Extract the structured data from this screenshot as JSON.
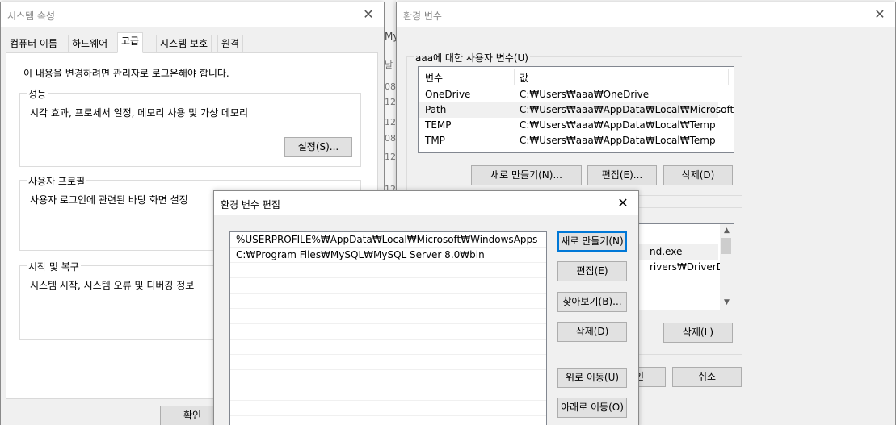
{
  "system_properties": {
    "title": "시스템 속성",
    "tabs": [
      {
        "label": "컴퓨터 이름"
      },
      {
        "label": "하드웨어"
      },
      {
        "label": "고급"
      },
      {
        "label": "시스템 보호"
      },
      {
        "label": "원격"
      }
    ],
    "admin_notice": "이 내용을 변경하려면 관리자로 로그온해야 합니다.",
    "performance": {
      "title": "성능",
      "description": "시각 효과, 프로세서 일정, 메모리 사용 및 가상 메모리",
      "settings_button": "설정(S)..."
    },
    "user_profile": {
      "title": "사용자 프로필",
      "description": "사용자 로그인에 관련된 바탕 화면 설정"
    },
    "startup_recovery": {
      "title": "시작 및 복구",
      "description": "시스템 시작, 시스템 오류 및 디버깅 정보"
    },
    "ok_button": "확인"
  },
  "background_fragments": [
    "My",
    "날",
    "08",
    "12",
    "12",
    "08",
    "12",
    "12"
  ],
  "environment_variables": {
    "title": "환경 변수",
    "user_group_title": "aaa에 대한 사용자 변수(U)",
    "columns": {
      "name": "변수",
      "value": "값"
    },
    "user_vars": [
      {
        "name": "OneDrive",
        "value": "C:₩Users₩aaa₩OneDrive"
      },
      {
        "name": "Path",
        "value": "C:₩Users₩aaa₩AppData₩Local₩Microsoft..."
      },
      {
        "name": "TEMP",
        "value": "C:₩Users₩aaa₩AppData₩Local₩Temp"
      },
      {
        "name": "TMP",
        "value": "C:₩Users₩aaa₩AppData₩Local₩Temp"
      }
    ],
    "user_buttons": {
      "new": "새로 만들기(N)...",
      "edit": "편집(E)...",
      "delete": "삭제(D)"
    },
    "system_vars_visible": [
      "nd.exe",
      "rivers₩DriverData"
    ],
    "system_buttons": {
      "delete": "삭제(L)"
    },
    "ok_partial": "인",
    "cancel_button": "취소"
  },
  "edit_dialog": {
    "title": "환경 변수 편집",
    "paths": [
      "%USERPROFILE%₩AppData₩Local₩Microsoft₩WindowsApps",
      "C:₩Program Files₩MySQL₩MySQL Server 8.0₩bin"
    ],
    "buttons": {
      "new": "새로 만들기(N)",
      "edit": "편집(E)",
      "browse": "찾아보기(B)...",
      "delete": "삭제(D)",
      "move_up": "위로 이동(U)",
      "move_down": "아래로 이동(O)"
    }
  }
}
